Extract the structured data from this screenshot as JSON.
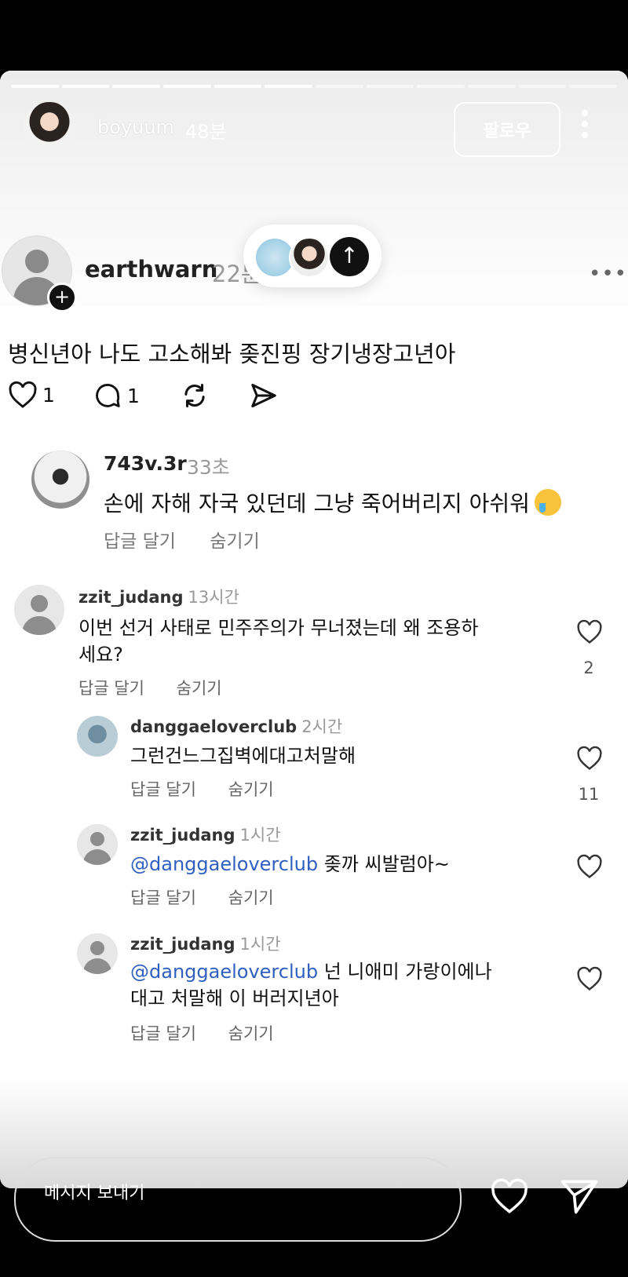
{
  "story": {
    "username": "boyuum",
    "time": "48분",
    "follow_label": "팔로우",
    "more_icon": "more-vertical-icon"
  },
  "post": {
    "username": "earthwarn",
    "time": "22분",
    "text": "병신년아 나도 고소해봐 좆진핑 장기냉장고년아",
    "likes": "1",
    "comments": "1",
    "more": "•••"
  },
  "reply_card": {
    "username": "743v.3r",
    "time": "33초",
    "text": "손에 자해 자국 있던데 그냥 죽어버리지 아쉬워",
    "reply_label": "답글 달기",
    "hide_label": "숨기기"
  },
  "comments": [
    {
      "username": "zzit_judang",
      "time": "13시간",
      "text_line1": "이번 선거 사태로 민주주의가 무너졌는데 왜 조용하",
      "text_line2": "세요?",
      "likes": "2",
      "reply_label": "답글 달기",
      "hide_label": "숨기기"
    },
    {
      "username": "danggaeloverclub",
      "time": "2시간",
      "text": "그런건느그집벽에대고처말해",
      "likes": "11",
      "reply_label": "답글 달기",
      "hide_label": "숨기기"
    },
    {
      "username": "zzit_judang",
      "time": "1시간",
      "mention": "@danggaeloverclub",
      "text": "좆까 씨발럼아~",
      "reply_label": "답글 달기",
      "hide_label": "숨기기"
    },
    {
      "username": "zzit_judang",
      "time": "1시간",
      "mention": "@danggaeloverclub",
      "text_line1": "넌 니애미 가랑이에나",
      "text_line2": "대고 처말해 이 버러지년아",
      "reply_label": "답글 달기",
      "hide_label": "숨기기"
    }
  ],
  "message_bar": {
    "placeholder": "메시지 보내기"
  },
  "colors": {
    "mention": "#2f5fbf",
    "background": "#000000"
  }
}
